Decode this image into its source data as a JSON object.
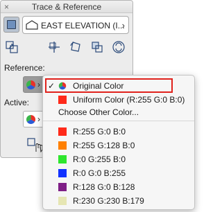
{
  "palette": {
    "title": "Trace & Reference",
    "close_symbol": "×",
    "view_toggle_icon": "trace-view-icon",
    "elevation": {
      "icon": "elevation-icon",
      "value": "EAST ELEVATION (I...",
      "chevron": "›"
    },
    "tools": [
      "move-icon",
      "rotate-icon",
      "mirror-icon",
      "swap-icon",
      "reset-icon"
    ],
    "reference_label": "Reference:",
    "active_label": "Active:",
    "chevron": "›"
  },
  "menu": {
    "check": "✓",
    "items": [
      {
        "label": "Original Color",
        "icon": "original-color-pie-icon",
        "checked": true
      },
      {
        "label": "Uniform Color (R:255 G:0 B:0)",
        "color": "#ff2a1a"
      },
      {
        "label": "Choose Other Color..."
      }
    ],
    "colors": [
      {
        "label": "R:255 G:0 B:0",
        "color": "#ff2a1a"
      },
      {
        "label": "R:255 G:128 B:0",
        "color": "#ff8000"
      },
      {
        "label": "R:0 G:255 B:0",
        "color": "#2ee62e"
      },
      {
        "label": "R:0 G:0 B:255",
        "color": "#1232ff"
      },
      {
        "label": "R:128 G:0 B:128",
        "color": "#7f1f86"
      },
      {
        "label": "R:230 G:230 B:179",
        "color": "#e6e6b3"
      }
    ]
  },
  "highlight_color": "#e0221c"
}
